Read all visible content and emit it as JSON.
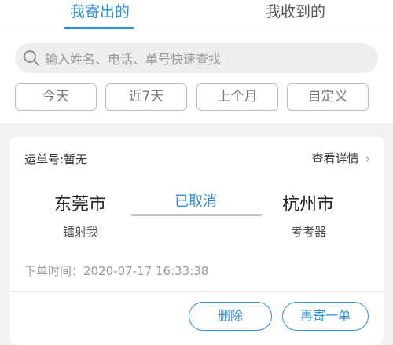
{
  "tabs": {
    "sent": "我寄出的",
    "received": "我收到的"
  },
  "search": {
    "placeholder": "输入姓名、电话、单号快速查找"
  },
  "filters": [
    "今天",
    "近7天",
    "上个月",
    "自定义"
  ],
  "order": {
    "waybill": "运单号:暂无",
    "detail_label": "查看详情",
    "from_city": "东莞市",
    "from_name": "镭射我",
    "to_city": "杭州市",
    "to_name": "考考器",
    "status": "已取消",
    "time": "下单时间：2020-07-17 16:33:38",
    "delete_label": "删除",
    "reship_label": "再寄一单"
  }
}
